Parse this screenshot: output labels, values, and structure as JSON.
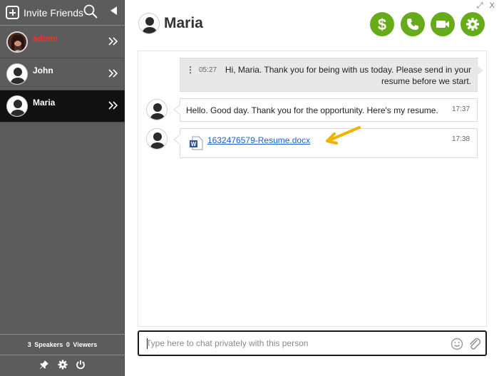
{
  "sidebar": {
    "invite_label": "Invite Friends",
    "users": [
      {
        "name": "admin",
        "role": "admin"
      },
      {
        "name": "John",
        "role": "user"
      },
      {
        "name": "Maria",
        "role": "user",
        "active": true
      }
    ],
    "stats": {
      "speakers_count": "3",
      "speakers_label": "Speakers",
      "viewers_count": "0",
      "viewers_label": "Viewers"
    }
  },
  "header": {
    "contact_name": "Maria",
    "window_controls": {
      "expand": "⤢",
      "close": "X"
    },
    "actions": [
      "dollar-icon",
      "phone-icon",
      "video-icon",
      "gear-icon"
    ],
    "accent_color": "#66ac1a"
  },
  "messages": [
    {
      "from": "self",
      "time": "05:27",
      "text": "Hi, Maria. Thank you for being with us today. Please send in your resume before we start."
    },
    {
      "from": "Maria",
      "time": "17:37",
      "text": "Hello. Good day. Thank you for the opportunity. Here's my resume."
    },
    {
      "from": "Maria",
      "time": "17:38",
      "file": "1632476579-Resume.docx"
    }
  ],
  "composer": {
    "placeholder": "Type here to chat privately with this person"
  },
  "colors": {
    "sidebar_bg": "#5c5c5c",
    "active_row_bg": "#111111",
    "admin_name": "#ff2b2b",
    "link": "#1b5fd0",
    "arrow": "#f0b400"
  }
}
